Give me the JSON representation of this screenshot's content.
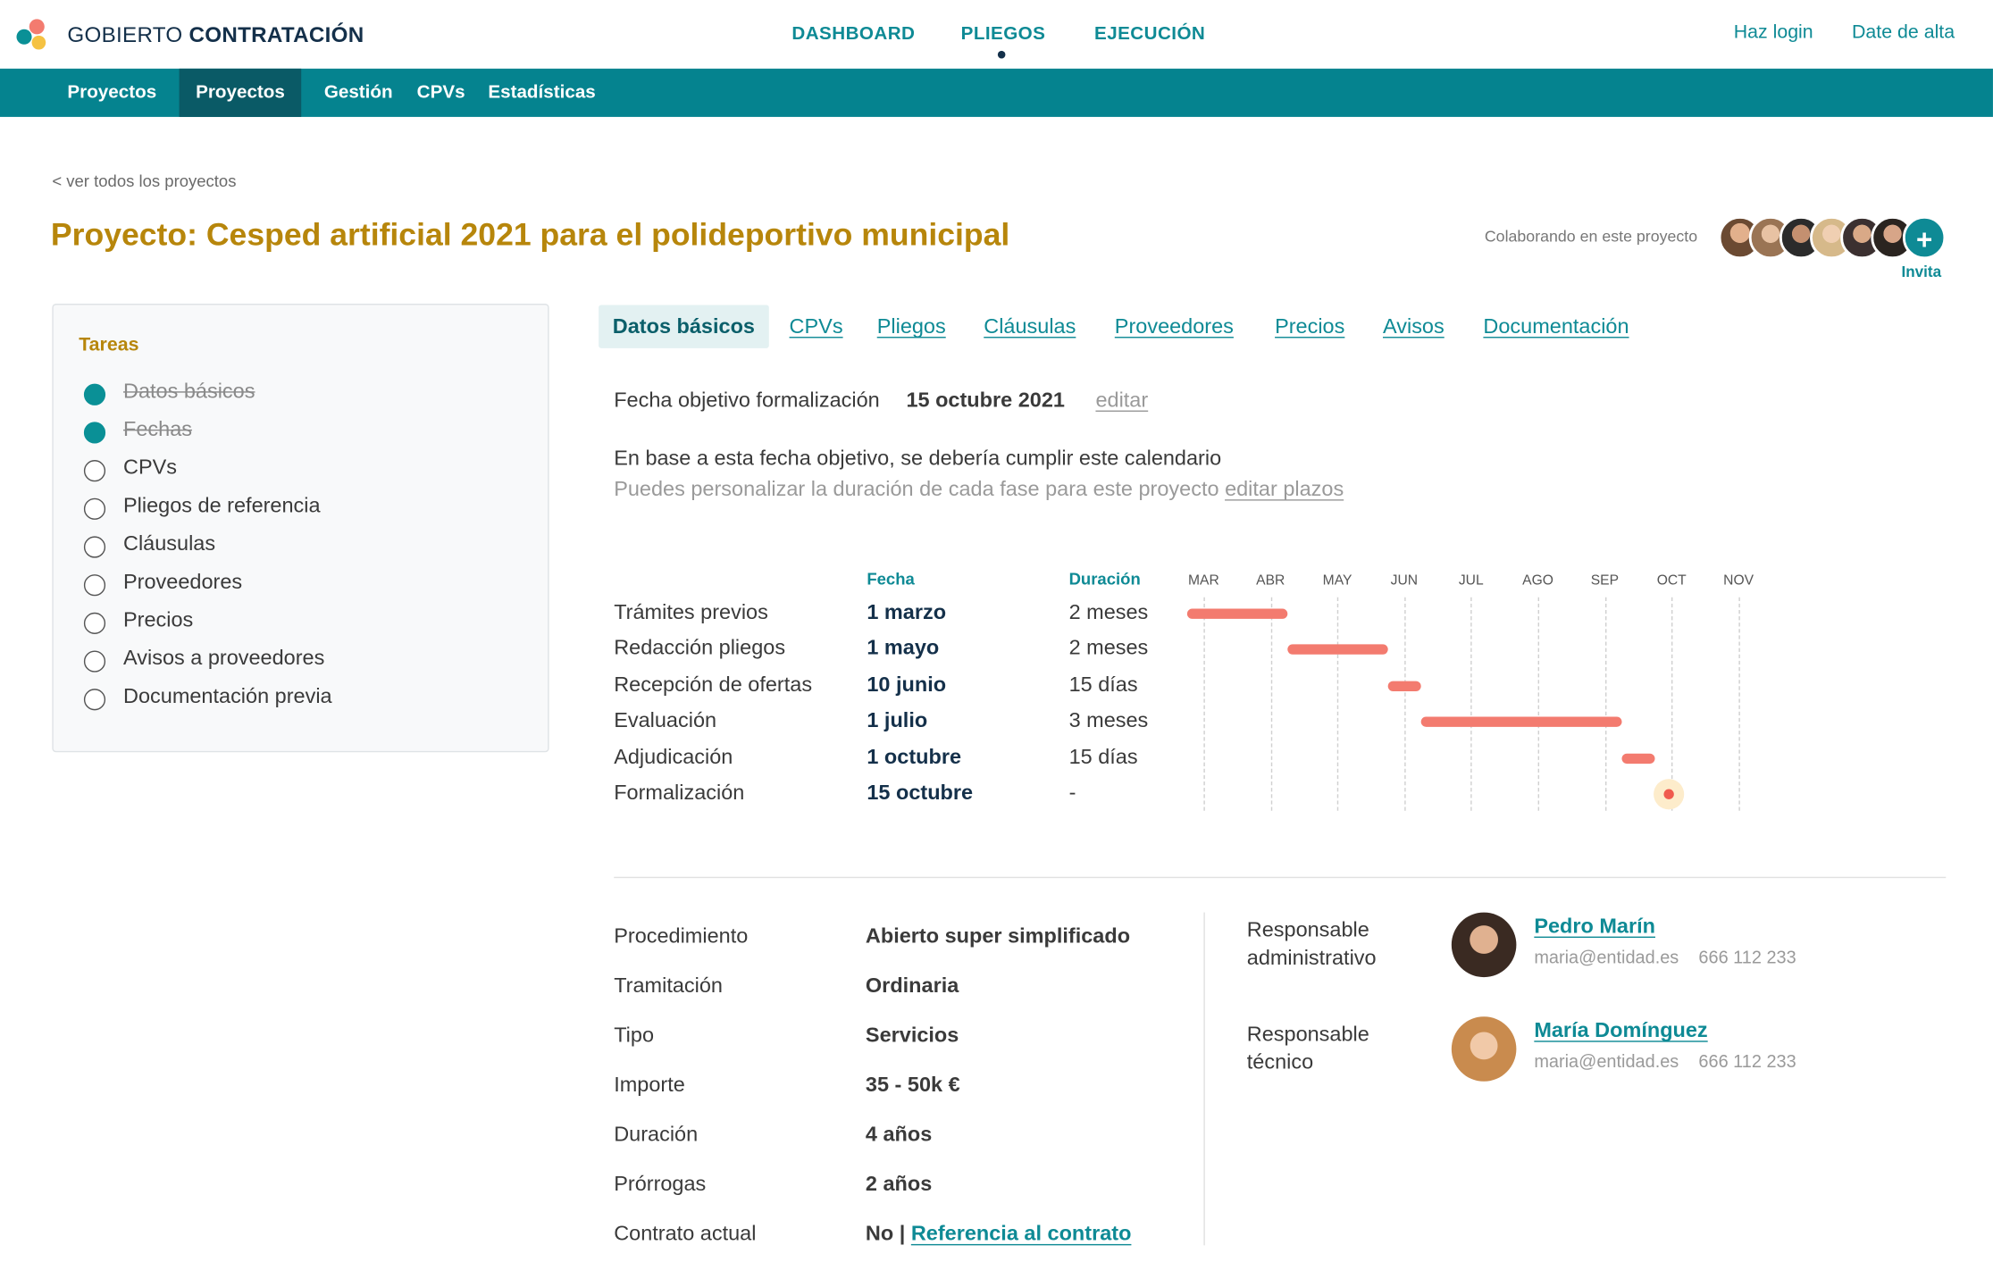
{
  "brand": {
    "light": "GOBIERTO ",
    "bold": "CONTRATACIÓN"
  },
  "main_nav": [
    {
      "label": "DASHBOARD"
    },
    {
      "label": "PLIEGOS",
      "active": true
    },
    {
      "label": "EJECUCIÓN"
    }
  ],
  "auth": {
    "login": "Haz login",
    "signup": "Date de alta"
  },
  "sub_nav": [
    {
      "label": "Proyectos"
    },
    {
      "label": "Proyectos",
      "active": true
    },
    {
      "label": "Gestión"
    },
    {
      "label": "CPVs"
    },
    {
      "label": "Estadísticas"
    }
  ],
  "back_link": "< ver todos los proyectos",
  "page_title": "Proyecto: Cesped artificial 2021 para el polideportivo municipal",
  "collaborators": {
    "label": "Colaborando en este proyecto",
    "invite_label": "Invita",
    "invite_icon": "plus-icon",
    "count": 6
  },
  "tasks": {
    "title": "Tareas",
    "items": [
      {
        "label": "Datos básicos",
        "done": true
      },
      {
        "label": "Fechas",
        "done": true
      },
      {
        "label": "CPVs",
        "done": false
      },
      {
        "label": "Pliegos de referencia",
        "done": false
      },
      {
        "label": "Cláusulas",
        "done": false
      },
      {
        "label": "Proveedores",
        "done": false
      },
      {
        "label": "Precios",
        "done": false
      },
      {
        "label": "Avisos a proveedores",
        "done": false
      },
      {
        "label": "Documentación previa",
        "done": false
      }
    ]
  },
  "tabs": [
    {
      "label": "Datos básicos",
      "active": true
    },
    {
      "label": "CPVs"
    },
    {
      "label": "Pliegos"
    },
    {
      "label": "Cláusulas"
    },
    {
      "label": "Proveedores"
    },
    {
      "label": "Precios"
    },
    {
      "label": "Avisos"
    },
    {
      "label": "Documentación"
    }
  ],
  "target": {
    "label": "Fecha objetivo formalización",
    "value": "15 octubre 2021",
    "edit": "editar"
  },
  "calendar_intro": {
    "line1": "En base a esta fecha objetivo, se debería cumplir este calendario",
    "line2": "Puedes personalizar la duración de cada fase para este proyecto ",
    "edit_link": "editar plazos"
  },
  "gantt": {
    "headers": {
      "date": "Fecha",
      "duration": "Duración"
    },
    "months": [
      "MAR",
      "ABR",
      "MAY",
      "JUN",
      "JUL",
      "AGO",
      "SEP",
      "OCT",
      "NOV"
    ],
    "phases": [
      {
        "name": "Trámites previos",
        "date": "1 marzo",
        "duration": "2 meses",
        "start": 0.0,
        "end": 1.5
      },
      {
        "name": "Redacción pliegos",
        "date": "1 mayo",
        "duration": "2 meses",
        "start": 1.5,
        "end": 3.0
      },
      {
        "name": "Recepción de ofertas",
        "date": "10 junio",
        "duration": "15 días",
        "start": 3.0,
        "end": 3.5
      },
      {
        "name": "Evaluación",
        "date": "1 julio",
        "duration": "3 meses",
        "start": 3.5,
        "end": 6.5
      },
      {
        "name": "Adjudicación",
        "date": "1 octubre",
        "duration": "15 días",
        "start": 6.5,
        "end": 7.0
      },
      {
        "name": "Formalización",
        "date": "15 octubre",
        "duration": "-",
        "milestone": 6.95
      }
    ],
    "colors": {
      "bar": "#f37b6f",
      "milestone": "#f05a4e",
      "halo": "#fdeccb"
    }
  },
  "properties": [
    {
      "label": "Procedimiento",
      "value": "Abierto super simplificado"
    },
    {
      "label": "Tramitación",
      "value": "Ordinaria"
    },
    {
      "label": "Tipo",
      "value": "Servicios"
    },
    {
      "label": "Importe",
      "value": "35 - 50k €"
    },
    {
      "label": "Duración",
      "value": "4 años"
    },
    {
      "label": "Prórrogas",
      "value": "2 años"
    },
    {
      "label": "Contrato actual",
      "value": "No | ",
      "link": "Referencia al contrato"
    }
  ],
  "responsibles": [
    {
      "role": "Responsable administrativo",
      "name": "Pedro Marín",
      "email": "maria@entidad.es",
      "phone": "666 112 233"
    },
    {
      "role": "Responsable técnico",
      "name": "María Domínguez",
      "email": "maria@entidad.es",
      "phone": "666 112 233"
    }
  ],
  "colors": {
    "teal": "#0e8a95",
    "gold": "#b7860b",
    "subnav": "#05838f",
    "subnav_active": "#0a5a66"
  }
}
